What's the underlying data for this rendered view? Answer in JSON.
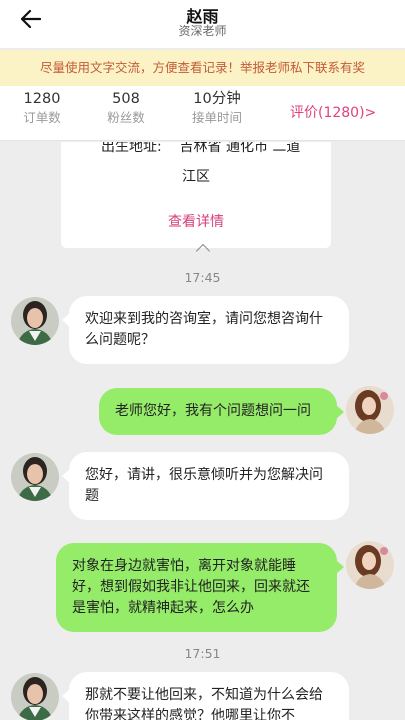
{
  "header": {
    "title": "赵雨",
    "subtitle": "资深老师",
    "back_icon": "arrow-left-icon"
  },
  "notice": {
    "text": "尽量使用文字交流，方便查看记录！举报老师私下联系有奖"
  },
  "stats": {
    "orders": {
      "value": "1280",
      "label": "订单数"
    },
    "fans": {
      "value": "508",
      "label": "粉丝数"
    },
    "response_time": {
      "value": "10分钟",
      "label": "接单时间"
    },
    "rating_link": "评价(1280)>"
  },
  "info_card": {
    "birthplace_label": "出生地址:",
    "birthplace_value_line1": "吉林省 通化市 二道",
    "birthplace_value_line2": "江区",
    "detail_link": "查看详情"
  },
  "messages": [
    {
      "type": "time",
      "text": "17:45"
    },
    {
      "type": "teacher",
      "text": "欢迎来到我的咨询室，请问您想咨询什么问题呢？"
    },
    {
      "type": "user",
      "text": "老师您好，我有个问题想问一问"
    },
    {
      "type": "teacher",
      "text": "您好，请讲，很乐意倾听并为您解决问题"
    },
    {
      "type": "user",
      "text": "对象在身边就害怕，离开对象就能睡好，想到假如我非让他回来，回来就还是害怕，就精神起来，怎么办"
    },
    {
      "type": "time",
      "text": "17:51"
    },
    {
      "type": "teacher",
      "text": "那就不要让他回来，不知道为什么会给你带来这样的感觉？他哪里让你不"
    }
  ],
  "colors": {
    "notice_bg": "#fbf2c5",
    "notice_text": "#c45b3a",
    "accent_pink": "#e0407e",
    "user_bubble": "#95ec69",
    "chat_bg": "#ededed"
  }
}
